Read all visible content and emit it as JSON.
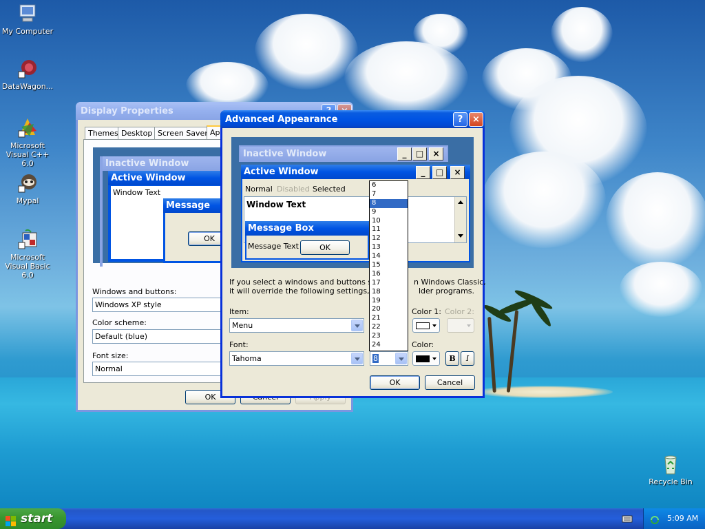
{
  "desktop": {
    "icons": [
      {
        "label": "My Computer"
      },
      {
        "label": "DataWagon..."
      },
      {
        "label": "Microsoft Visual C++ 6.0"
      },
      {
        "label": "Mypal"
      },
      {
        "label": "Microsoft Visual Basic 6.0"
      },
      {
        "label": "Recycle Bin"
      }
    ]
  },
  "display_properties": {
    "title": "Display Properties",
    "tabs": [
      "Themes",
      "Desktop",
      "Screen Saver",
      "Ap"
    ],
    "preview": {
      "inactive_title": "Inactive Window",
      "active_title": "Active Window",
      "window_text": "Window Text",
      "message_box": "Message Box",
      "ok": "OK"
    },
    "windows_buttons_label": "Windows and buttons:",
    "windows_buttons_value": "Windows XP style",
    "color_scheme_label": "Color scheme:",
    "color_scheme_value": "Default (blue)",
    "font_size_label": "Font size:",
    "font_size_value": "Normal",
    "ok": "OK",
    "cancel": "Cancel",
    "apply": "Apply"
  },
  "advanced_appearance": {
    "title": "Advanced Appearance",
    "preview": {
      "inactive_title": "Inactive Window",
      "active_title": "Active Window",
      "menu_normal": "Normal",
      "menu_disabled": "Disabled",
      "menu_selected": "Selected",
      "window_text": "Window Text",
      "message_box": "Message Box",
      "message_text": "Message Text",
      "ok": "OK"
    },
    "info_line1": "If you select a windows and buttons setti",
    "info_line1_tail": "n Windows Classic,",
    "info_line2": "it will override the following settings, exce",
    "info_line2_tail": "lder programs.",
    "item_label": "Item:",
    "item_value": "Menu",
    "color1_label": "Color 1:",
    "color2_label": "Color 2:",
    "font_label": "Font:",
    "font_value": "Tahoma",
    "color_label": "Color:",
    "size_value": "8",
    "bold": "B",
    "italic": "I",
    "ok": "OK",
    "cancel": "Cancel",
    "size_options": [
      "6",
      "7",
      "8",
      "9",
      "10",
      "11",
      "12",
      "13",
      "14",
      "15",
      "16",
      "17",
      "18",
      "19",
      "20",
      "21",
      "22",
      "23",
      "24"
    ],
    "size_selected": "8",
    "colors": {
      "color1": "#ffffff",
      "color": "#000000"
    }
  },
  "taskbar": {
    "start": "start",
    "clock": "5:09 AM"
  }
}
